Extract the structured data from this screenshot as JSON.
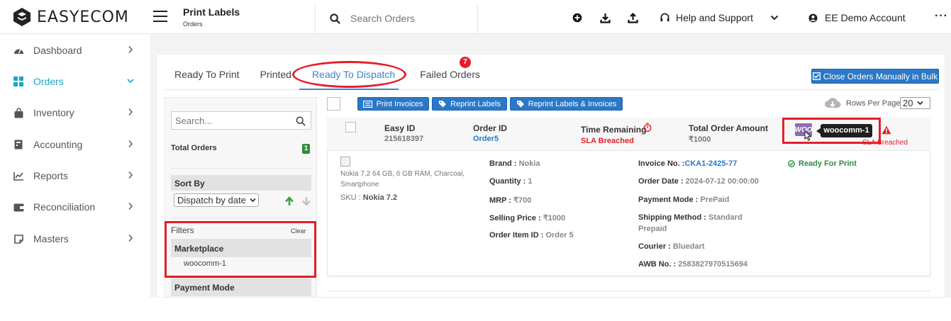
{
  "brand": {
    "name": "EASYECOM",
    "logo_icon": "easyecom-logo-icon"
  },
  "header": {
    "title": "Print Labels",
    "subtitle": "Orders",
    "search_placeholder": "Search Orders",
    "icons": [
      "plus-circle-icon",
      "download-icon",
      "upload-icon"
    ],
    "help_label": "Help and Support",
    "account_label": "EE Demo Account"
  },
  "sidebar": {
    "items": [
      {
        "label": "Dashboard",
        "icon": "dashboard-icon"
      },
      {
        "label": "Orders",
        "icon": "grid-icon",
        "active": true
      },
      {
        "label": "Inventory",
        "icon": "bag-icon"
      },
      {
        "label": "Accounting",
        "icon": "ledger-icon"
      },
      {
        "label": "Reports",
        "icon": "chart-icon"
      },
      {
        "label": "Reconciliation",
        "icon": "wallet-icon"
      },
      {
        "label": "Masters",
        "icon": "note-icon"
      }
    ]
  },
  "tabs": {
    "items": [
      "Ready To Print",
      "Printed",
      "Ready To Dispatch",
      "Failed Orders"
    ],
    "active": "Ready To Dispatch",
    "failed_badge": "7"
  },
  "actions": {
    "close_bulk": "Close Orders Manually in Bulk",
    "print_invoices": "Print Invoices",
    "reprint_labels": "Reprint Labels",
    "reprint_both": "Reprint Labels & Invoices",
    "rows_per_page_label": "Rows Per Page",
    "rows_per_page_value": "20"
  },
  "filters": {
    "search_placeholder": "Search...",
    "total_orders_label": "Total Orders",
    "total_orders_count": "1",
    "sort_by_label": "Sort By",
    "sort_by_value": "Dispatch by date",
    "filters_label": "Filters",
    "clear_label": "Clear",
    "marketplace_label": "Marketplace",
    "marketplace_value": "woocomm-1",
    "payment_mode_label": "Payment Mode"
  },
  "order": {
    "easy_id_label": "Easy ID",
    "easy_id": "215618397",
    "order_id_label": "Order ID",
    "order_id": "Order5",
    "time_remaining_label": "Time Remaining",
    "time_remaining": "SLA Breached",
    "total_amount_label": "Total Order Amount",
    "total_amount": "₹1000",
    "marketplace_logo": "WOO",
    "tooltip": "woocomm-1",
    "sla_small": "SLA Breached",
    "product_desc": "Nokia 7.2 64 GB, 6 GB RAM, Charcoal, Smartphone",
    "sku_label": "SKU :",
    "sku": "Nokia 7.2",
    "brand_label": "Brand :",
    "brand": "Nokia",
    "quantity_label": "Quantity :",
    "quantity": "1",
    "mrp_label": "MRP :",
    "mrp": "₹700",
    "selling_price_label": "Selling Price :",
    "selling_price": "₹1000",
    "order_item_id_label": "Order Item ID :",
    "order_item_id": "Order 5",
    "invoice_label": "Invoice No. :",
    "invoice": "CKA1-2425-77",
    "order_date_label": "Order Date :",
    "order_date": "2024-07-12 00:00:00",
    "payment_mode_label": "Payment Mode :",
    "payment_mode": "PrePaid",
    "shipping_label": "Shipping Method :",
    "shipping": "Standard",
    "shipping_2": "Prepaid",
    "courier_label": "Courier :",
    "courier": "Bluedart",
    "awb_label": "AWB No. :",
    "awb": "2583827970515694",
    "status": "Ready For Print"
  },
  "colors": {
    "accent": "#2a78c7",
    "active_nav": "#1aa5c8",
    "danger": "#e41e2b",
    "success": "#2e8b3e"
  }
}
